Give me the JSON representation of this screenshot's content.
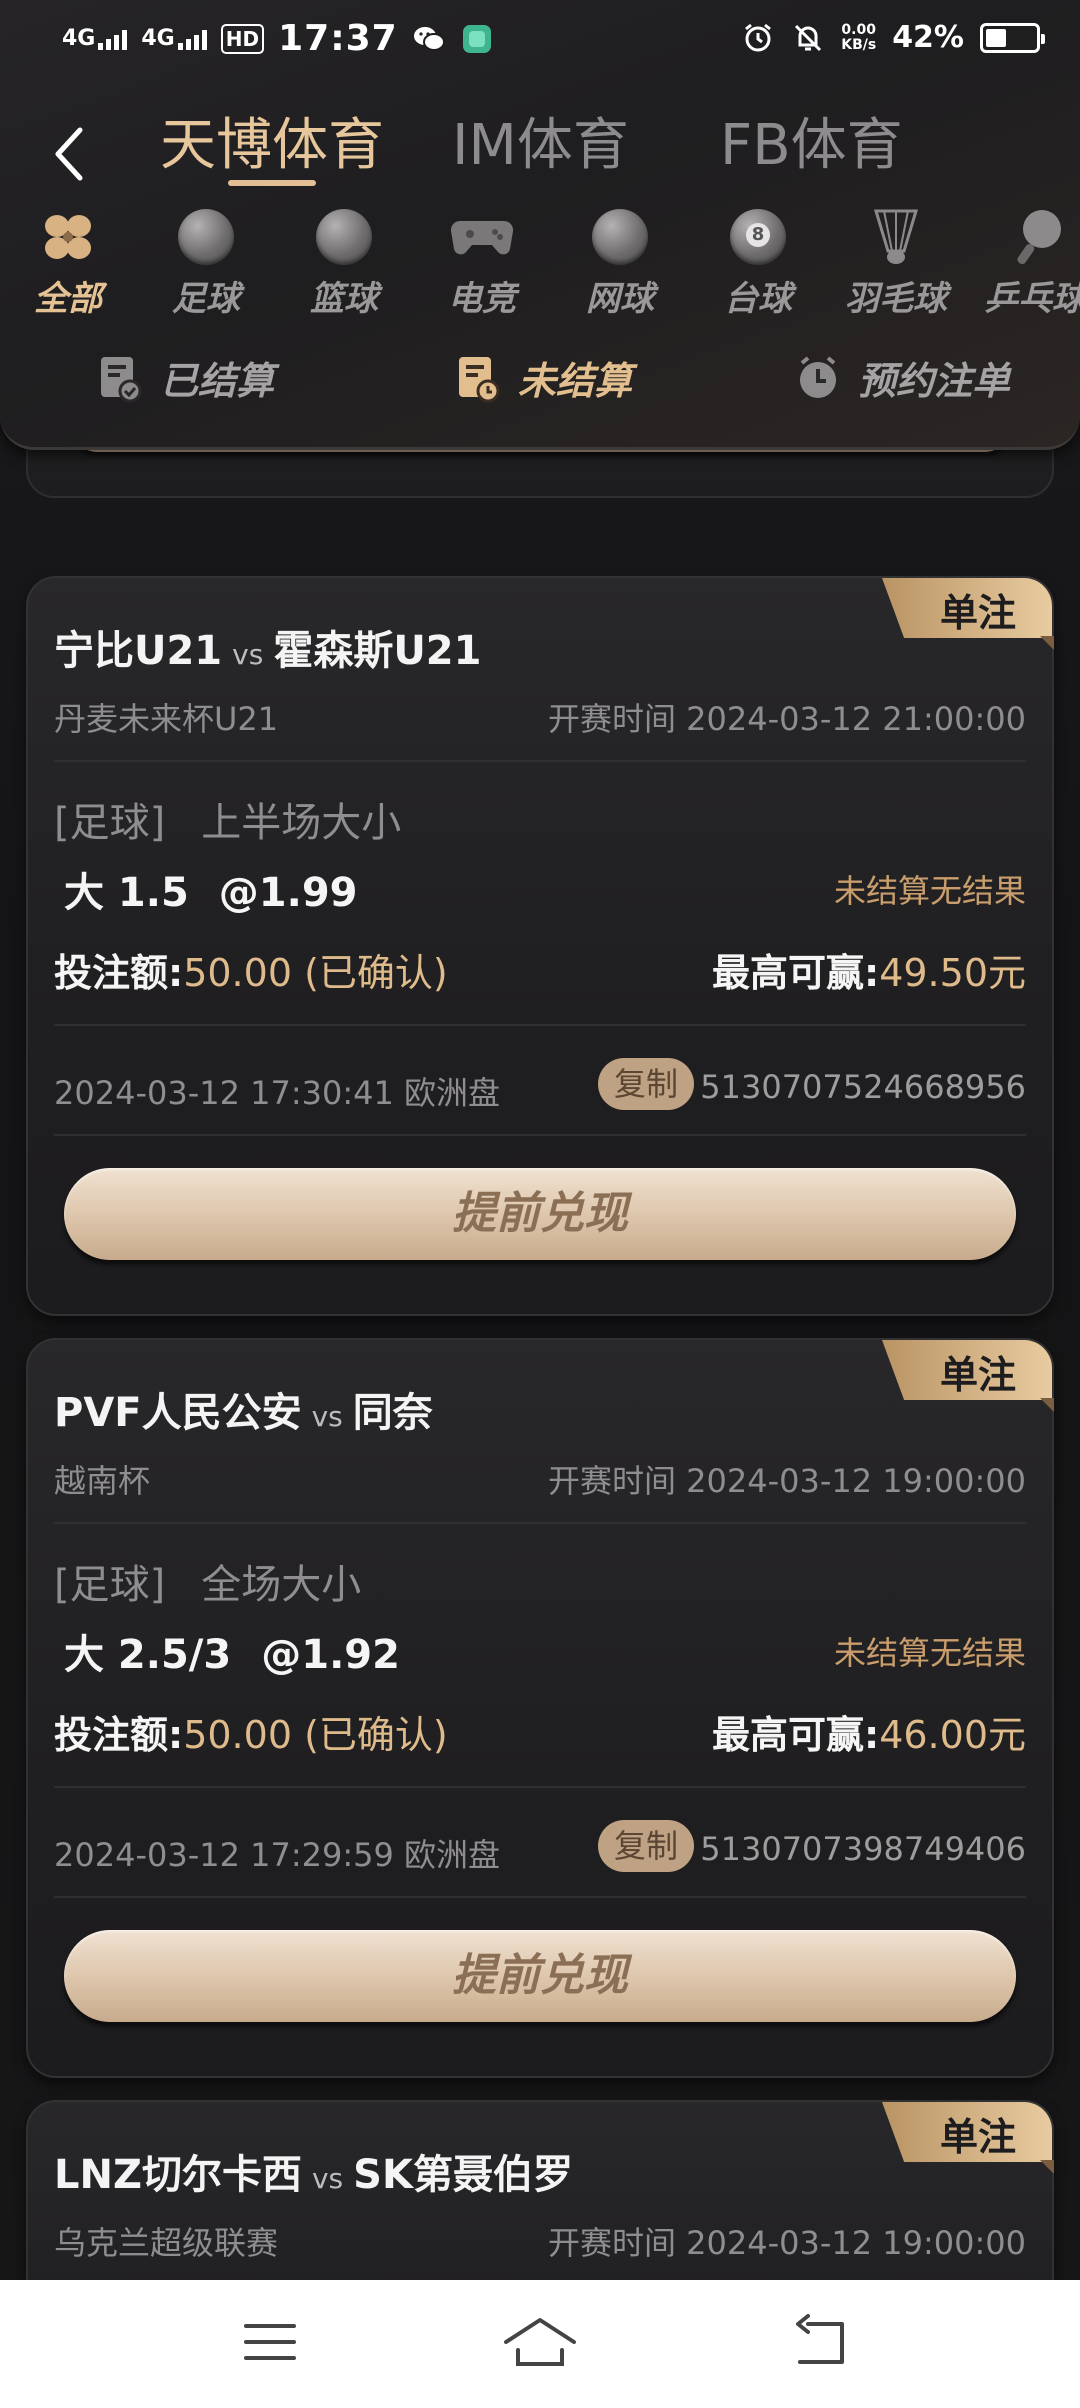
{
  "status_bar": {
    "network1": "4G",
    "network2": "4G",
    "hd": "HD",
    "time": "17:37",
    "speed_value": "0.00",
    "speed_unit": "KB/s",
    "battery": "42%",
    "battery_level": 0.42
  },
  "provider_tabs": [
    {
      "label": "天博体育",
      "active": true
    },
    {
      "label": "IM体育",
      "active": false
    },
    {
      "label": "FB体育",
      "active": false
    }
  ],
  "sports": [
    {
      "label": "全部",
      "icon": "grid-icon",
      "active": true
    },
    {
      "label": "足球",
      "icon": "soccer-ball-icon",
      "active": false
    },
    {
      "label": "篮球",
      "icon": "basketball-icon",
      "active": false
    },
    {
      "label": "电竞",
      "icon": "gamepad-icon",
      "active": false
    },
    {
      "label": "网球",
      "icon": "tennis-ball-icon",
      "active": false
    },
    {
      "label": "台球",
      "icon": "billiard-ball-icon",
      "active": false
    },
    {
      "label": "羽毛球",
      "icon": "shuttlecock-icon",
      "active": false
    },
    {
      "label": "乒乓球",
      "icon": "ping-pong-icon",
      "active": false
    }
  ],
  "status_tabs": [
    {
      "label": "已结算",
      "icon": "settled-icon",
      "active": false
    },
    {
      "label": "未结算",
      "icon": "unsettled-icon",
      "active": true
    },
    {
      "label": "预约注单",
      "icon": "clock-icon",
      "active": false
    }
  ],
  "bets": [
    {
      "badge": "单注",
      "home": "宁比U21",
      "vs": "vs",
      "away": "霍森斯U21",
      "league": "丹麦未来杯U21",
      "start_time": "开赛时间 2024-03-12 21:00:00",
      "sport": "[足球]",
      "market": "上半场大小",
      "selection": "大 1.5",
      "odds": "@1.99",
      "result": "未结算无结果",
      "stake_label": "投注额:",
      "stake": "50.00 (已确认)",
      "win_label": "最高可赢:",
      "win": "49.50元",
      "bet_time": "2024-03-12 17:30:41 欧洲盘",
      "copy": "复制",
      "order_id": "5130707524668956",
      "cashout": "提前兑现"
    },
    {
      "badge": "单注",
      "home": "PVF人民公安",
      "vs": "vs",
      "away": "同奈",
      "league": "越南杯",
      "start_time": "开赛时间 2024-03-12 19:00:00",
      "sport": "[足球]",
      "market": "全场大小",
      "selection": "大 2.5/3",
      "odds": "@1.92",
      "result": "未结算无结果",
      "stake_label": "投注额:",
      "stake": "50.00 (已确认)",
      "win_label": "最高可赢:",
      "win": "46.00元",
      "bet_time": "2024-03-12 17:29:59 欧洲盘",
      "copy": "复制",
      "order_id": "5130707398749406",
      "cashout": "提前兑现"
    },
    {
      "badge": "单注",
      "home": "LNZ切尔卡西",
      "vs": "vs",
      "away": "SK第聂伯罗",
      "league": "乌克兰超级联赛",
      "start_time": "开赛时间 2024-03-12 19:00:00"
    }
  ],
  "colors": {
    "accent": "#e3bf90",
    "odds_gold": "#dfbb8b",
    "background": "#141416"
  }
}
